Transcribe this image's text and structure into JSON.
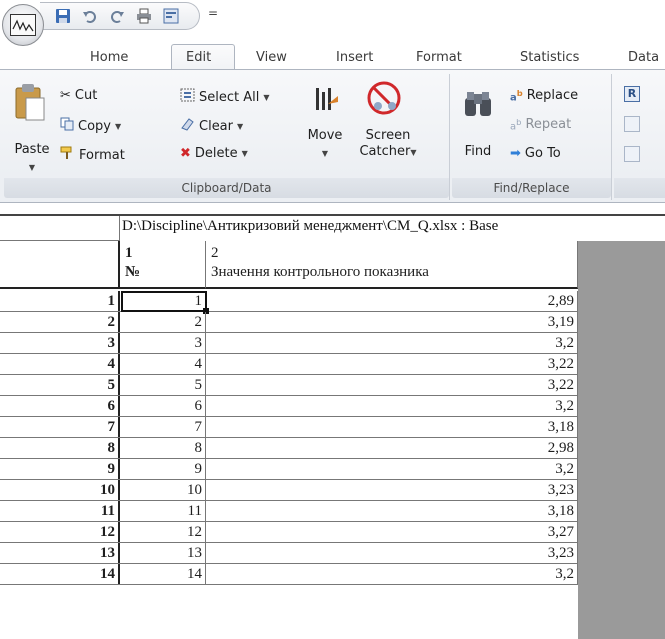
{
  "qat": {
    "icons": [
      "app-logo-icon",
      "save-icon",
      "undo-icon",
      "redo-icon",
      "print-icon",
      "customize-icon"
    ],
    "more": "="
  },
  "tabs": [
    {
      "label": "Home"
    },
    {
      "label": "Edit"
    },
    {
      "label": "View"
    },
    {
      "label": "Insert"
    },
    {
      "label": "Format"
    },
    {
      "label": "Statistics"
    },
    {
      "label": "Data"
    }
  ],
  "ribbon": {
    "clipboard": {
      "label": "Clipboard/Data",
      "paste": "Paste",
      "cut": "Cut",
      "copy": "Copy",
      "format": "Format",
      "select_all": "Select All",
      "clear": "Clear",
      "delete": "Delete",
      "move": "Move",
      "screen_catcher_1": "Screen",
      "screen_catcher_2": "Catcher"
    },
    "find_replace": {
      "label": "Find/Replace",
      "find": "Find",
      "replace": "Replace",
      "repeat": "Repeat",
      "goto": "Go To"
    },
    "next_group": {
      "letter": "R"
    }
  },
  "sheet": {
    "file_path": "D:\\Discipline\\Антикризовий менеджмент\\CM_Q.xlsx : Base",
    "col1": {
      "num": "1",
      "name": "№"
    },
    "col2": {
      "num": "2",
      "name": "Значення контрольного показника"
    },
    "rows": [
      {
        "row": "1",
        "n": "1",
        "v": "2,89"
      },
      {
        "row": "2",
        "n": "2",
        "v": "3,19"
      },
      {
        "row": "3",
        "n": "3",
        "v": "3,2"
      },
      {
        "row": "4",
        "n": "4",
        "v": "3,22"
      },
      {
        "row": "5",
        "n": "5",
        "v": "3,22"
      },
      {
        "row": "6",
        "n": "6",
        "v": "3,2"
      },
      {
        "row": "7",
        "n": "7",
        "v": "3,18"
      },
      {
        "row": "8",
        "n": "8",
        "v": "2,98"
      },
      {
        "row": "9",
        "n": "9",
        "v": "3,2"
      },
      {
        "row": "10",
        "n": "10",
        "v": "3,23"
      },
      {
        "row": "11",
        "n": "11",
        "v": "3,18"
      },
      {
        "row": "12",
        "n": "12",
        "v": "3,27"
      },
      {
        "row": "13",
        "n": "13",
        "v": "3,23"
      },
      {
        "row": "14",
        "n": "14",
        "v": "3,2"
      }
    ]
  }
}
